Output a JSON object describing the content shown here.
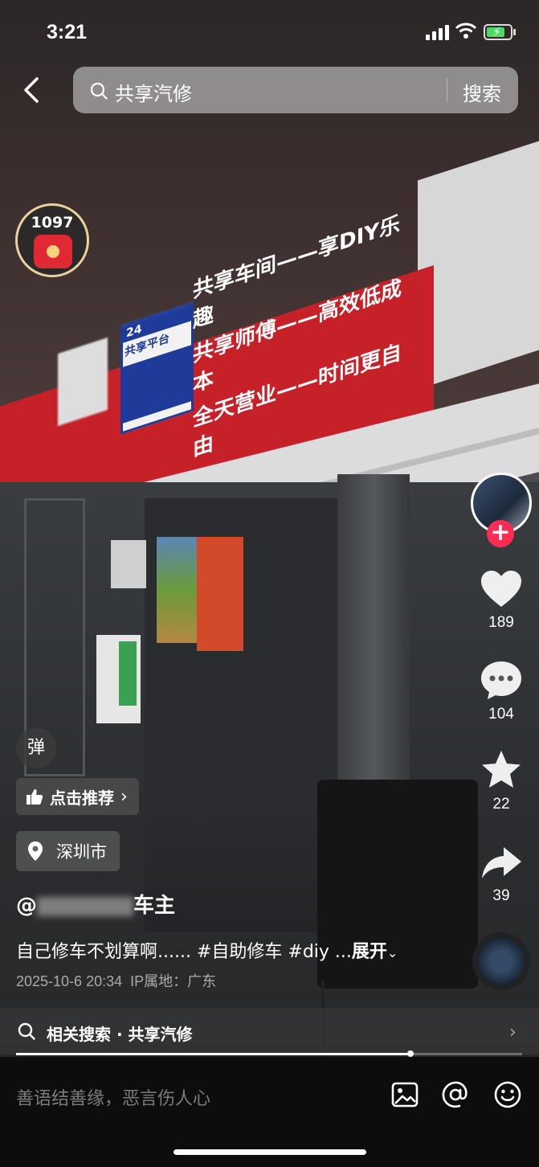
{
  "status_bar": {
    "time": "3:21"
  },
  "search": {
    "query": "共享汽修",
    "button": "搜索"
  },
  "red_packet": {
    "count": "1097"
  },
  "video_scene": {
    "banner_lines": [
      "共享车间——享DIY乐趣",
      "共享师傅——高效低成本",
      "全天营业——时间更自由"
    ],
    "banner_card_badge": "24",
    "banner_card_title": "共享平台"
  },
  "actions": {
    "likes": "189",
    "comments": "104",
    "favorites": "22",
    "shares": "39"
  },
  "overlay": {
    "danmu": "弹",
    "recommend": "点击推荐",
    "location": "深圳市",
    "author_prefix": "@",
    "author_suffix": "车主",
    "caption": "自己修车不划算啊...... #自助修车 #diy ...",
    "expand": "展开",
    "date": "2025-10-6 20:34",
    "ip": "IP属地：广东"
  },
  "related": {
    "label": "相关搜索 · 共享汽修"
  },
  "progress": 0.78,
  "comment": {
    "placeholder": "善语结善缘，恶言伤人心"
  }
}
